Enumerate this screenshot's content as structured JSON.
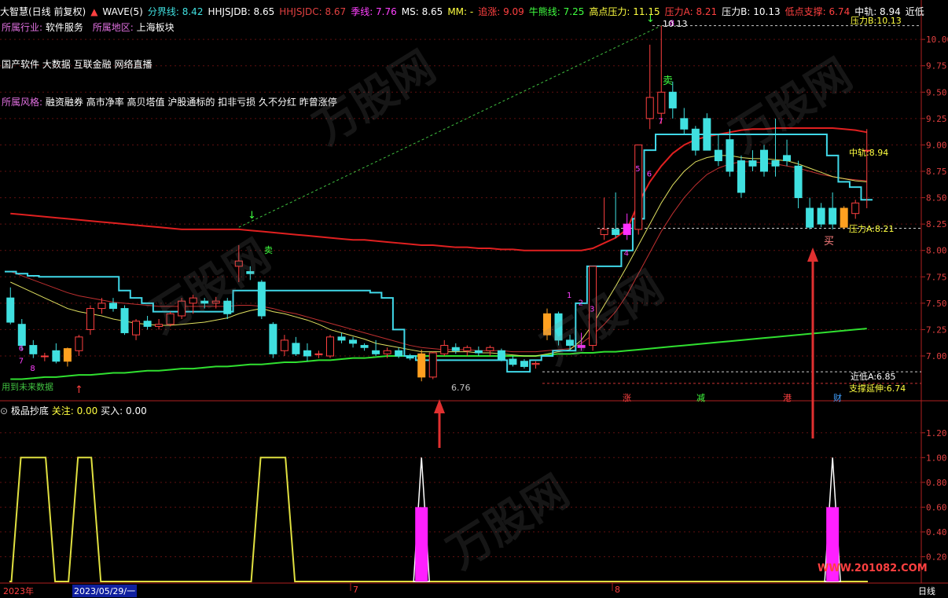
{
  "header": {
    "title": "大智慧(日线 前复权)",
    "indicator": "WAVE(5)",
    "items": [
      {
        "label": "分界线: 8.42",
        "color": "#40e0e0"
      },
      {
        "label": "HHJSJDB: 8.65",
        "color": "#ffffff"
      },
      {
        "label": "HHJSJDC: 8.67",
        "color": "#e04040"
      },
      {
        "label": "季线: 7.76",
        "color": "#ff40ff"
      },
      {
        "label": "MS: 8.65",
        "color": "#ffffff"
      },
      {
        "label": "MM: -",
        "color": "#ffff40"
      },
      {
        "label": "追涨: 9.09",
        "color": "#ff4040"
      },
      {
        "label": "牛熊线: 7.25",
        "color": "#40ff40"
      },
      {
        "label": "高点压力: 11.15",
        "color": "#ffff40"
      },
      {
        "label": "压力A: 8.21",
        "color": "#ff4040"
      },
      {
        "label": "压力B: 10.13",
        "color": "#ffffff"
      },
      {
        "label": "低点支撑: 6.74",
        "color": "#ff4040"
      },
      {
        "label": "中轨: 8.94",
        "color": "#ffffff"
      },
      {
        "label": "近低",
        "color": "#ffffff"
      }
    ]
  },
  "info": {
    "industry_label": "所属行业:",
    "industry_value": "软件服务",
    "region_label": "所属地区:",
    "region_value": "上海板块",
    "concepts": "国产软件 大数据 互联金融 网络直播",
    "style_label": "所属风格:",
    "style_value": "融资融券 高市净率 高贝塔值 沪股通标的 扣非亏损 久不分红 昨曾涨停"
  },
  "sub_header": {
    "name": "极品抄底",
    "focus_label": "关注: 0.00",
    "buy_label": "买入: 0.00"
  },
  "annotations": {
    "sell1": "卖",
    "sell2": "卖",
    "buy": "买",
    "press_b": "10.13",
    "press_b_label": "压力B:10.13",
    "mid_label": "中轨:8.94",
    "press_a_label": "压力A:8.21",
    "near_low_label": "近低A:6.85",
    "support_label": "支撑延伸:6.74",
    "low_mark": "6.76",
    "used_data": "用到未来数据",
    "zhang": "涨",
    "jian": "减",
    "gang": "港",
    "cai": "财",
    "wave_labels": [
      "1",
      "2",
      "3",
      "4",
      "5",
      "6",
      "7",
      "8"
    ]
  },
  "bottom": {
    "year": "2023年",
    "date": "2023/05/29/一",
    "m7": "7",
    "m8": "8",
    "period": "日线"
  },
  "watermark": "万股网",
  "watermark_url": "WWW.201082.COM",
  "colors": {
    "up": "#ff4040",
    "down": "#40e0e0",
    "bg": "#000000"
  },
  "chart_data": {
    "type": "candlestick",
    "main_ylim": [
      6.65,
      10.15
    ],
    "main_yticks": [
      7.0,
      7.25,
      7.5,
      7.75,
      8.0,
      8.25,
      8.5,
      8.75,
      9.0,
      9.25,
      9.5,
      9.75,
      10.0
    ],
    "sub_ylim": [
      0,
      1.3
    ],
    "sub_yticks": [
      0.2,
      0.4,
      0.6,
      0.8,
      1.0,
      1.2
    ],
    "candles": [
      [
        7.55,
        7.65,
        7.3,
        7.32
      ],
      [
        7.3,
        7.35,
        7.05,
        7.1
      ],
      [
        7.1,
        7.15,
        6.98,
        7.02
      ],
      [
        7.0,
        7.03,
        6.95,
        7.0
      ],
      [
        7.05,
        7.12,
        6.93,
        6.95
      ],
      [
        6.95,
        7.08,
        6.9,
        7.07
      ],
      [
        7.05,
        7.2,
        7.0,
        7.18
      ],
      [
        7.25,
        7.48,
        7.2,
        7.45
      ],
      [
        7.45,
        7.55,
        7.4,
        7.5
      ],
      [
        7.5,
        7.55,
        7.42,
        7.45
      ],
      [
        7.45,
        7.48,
        7.2,
        7.22
      ],
      [
        7.2,
        7.35,
        7.15,
        7.33
      ],
      [
        7.33,
        7.38,
        7.25,
        7.28
      ],
      [
        7.28,
        7.35,
        7.25,
        7.3
      ],
      [
        7.3,
        7.42,
        7.28,
        7.4
      ],
      [
        7.38,
        7.55,
        7.35,
        7.52
      ],
      [
        7.5,
        7.58,
        7.4,
        7.55
      ],
      [
        7.52,
        7.55,
        7.45,
        7.5
      ],
      [
        7.5,
        7.56,
        7.45,
        7.52
      ],
      [
        7.52,
        7.55,
        7.35,
        7.4
      ],
      [
        7.85,
        8.05,
        7.7,
        7.9
      ],
      [
        7.8,
        7.85,
        7.72,
        7.78
      ],
      [
        7.7,
        7.72,
        7.35,
        7.38
      ],
      [
        7.3,
        7.32,
        6.98,
        7.02
      ],
      [
        7.05,
        7.2,
        7.0,
        7.15
      ],
      [
        7.12,
        7.18,
        7.0,
        7.02
      ],
      [
        7.05,
        7.12,
        6.95,
        7.0
      ],
      [
        7.02,
        7.05,
        6.98,
        7.02
      ],
      [
        7.0,
        7.2,
        6.98,
        7.18
      ],
      [
        7.18,
        7.22,
        7.12,
        7.15
      ],
      [
        7.15,
        7.18,
        7.08,
        7.12
      ],
      [
        7.1,
        7.12,
        7.05,
        7.08
      ],
      [
        7.05,
        7.15,
        7.0,
        7.02
      ],
      [
        7.02,
        7.08,
        6.98,
        7.05
      ],
      [
        7.05,
        7.08,
        6.98,
        7.0
      ],
      [
        7.0,
        7.02,
        6.96,
        6.98
      ],
      [
        7.02,
        7.06,
        6.76,
        6.8
      ],
      [
        6.8,
        7.04,
        6.78,
        7.03
      ],
      [
        7.02,
        7.15,
        7.0,
        7.1
      ],
      [
        7.08,
        7.12,
        7.02,
        7.05
      ],
      [
        7.05,
        7.1,
        7.0,
        7.08
      ],
      [
        7.05,
        7.09,
        7.0,
        7.03
      ],
      [
        7.05,
        7.1,
        7.0,
        7.08
      ],
      [
        7.05,
        7.07,
        6.95,
        6.97
      ],
      [
        6.97,
        7.0,
        6.9,
        6.92
      ],
      [
        6.95,
        6.97,
        6.88,
        6.9
      ],
      [
        6.92,
        6.95,
        6.88,
        6.93
      ],
      [
        7.2,
        7.45,
        7.15,
        7.4
      ],
      [
        7.4,
        7.42,
        7.1,
        7.15
      ],
      [
        7.15,
        7.2,
        7.05,
        7.1
      ],
      [
        7.08,
        7.22,
        7.05,
        7.1
      ],
      [
        7.1,
        7.85,
        7.05,
        7.85
      ],
      [
        8.15,
        8.5,
        8.1,
        8.2
      ],
      [
        8.2,
        8.55,
        8.12,
        8.15
      ],
      [
        8.15,
        8.35,
        8.1,
        8.25
      ],
      [
        8.2,
        9.0,
        8.15,
        9.0
      ],
      [
        9.25,
        9.95,
        9.15,
        9.45
      ],
      [
        9.3,
        10.13,
        9.2,
        9.5
      ],
      [
        9.5,
        9.6,
        9.25,
        9.35
      ],
      [
        9.25,
        9.35,
        9.1,
        9.15
      ],
      [
        9.15,
        9.18,
        8.9,
        8.95
      ],
      [
        9.25,
        9.3,
        8.95,
        8.95
      ],
      [
        8.95,
        9.1,
        8.8,
        8.85
      ],
      [
        9.05,
        9.15,
        8.7,
        8.75
      ],
      [
        8.85,
        8.9,
        8.5,
        8.55
      ],
      [
        8.85,
        8.95,
        8.75,
        8.8
      ],
      [
        8.95,
        9.0,
        8.7,
        8.75
      ],
      [
        8.85,
        9.25,
        8.7,
        8.8
      ],
      [
        8.9,
        9.05,
        8.8,
        8.85
      ],
      [
        8.8,
        8.85,
        8.4,
        8.5
      ],
      [
        8.4,
        8.5,
        8.2,
        8.22
      ],
      [
        8.4,
        8.45,
        8.22,
        8.25
      ],
      [
        8.4,
        8.55,
        8.2,
        8.25
      ],
      [
        8.4,
        8.42,
        8.2,
        8.22
      ],
      [
        8.35,
        8.48,
        8.3,
        8.45
      ],
      [
        8.95,
        9.15,
        8.4,
        8.95
      ]
    ],
    "filled_up_idx": [
      50,
      54
    ],
    "orange_idx": [
      5,
      36,
      47,
      73
    ],
    "magenta_idx": [
      50,
      54
    ],
    "boll_upper": [
      7.8,
      7.78,
      7.76,
      7.75,
      7.75,
      7.75,
      7.75,
      7.75,
      7.75,
      7.75,
      7.62,
      7.55,
      7.5,
      7.42,
      7.42,
      7.42,
      7.42,
      7.42,
      7.42,
      7.42,
      7.62,
      7.62,
      7.62,
      7.62,
      7.62,
      7.62,
      7.62,
      7.62,
      7.62,
      7.62,
      7.62,
      7.62,
      7.6,
      7.55,
      7.25,
      7.0,
      6.96,
      6.96,
      6.96,
      6.96,
      6.96,
      6.96,
      6.96,
      6.96,
      6.85,
      6.85,
      6.96,
      7.0,
      7.05,
      7.05,
      7.5,
      7.85,
      7.85,
      7.85,
      8.0,
      8.3,
      8.95,
      9.1,
      9.1,
      9.1,
      9.1,
      9.1,
      9.1,
      9.1,
      9.1,
      9.1,
      9.1,
      9.1,
      9.1,
      9.1,
      9.1,
      9.1,
      8.9,
      8.65,
      8.6,
      8.48
    ],
    "red_curve": [
      8.35,
      8.34,
      8.33,
      8.32,
      8.31,
      8.3,
      8.29,
      8.28,
      8.27,
      8.26,
      8.25,
      8.24,
      8.23,
      8.22,
      8.21,
      8.2,
      8.2,
      8.2,
      8.2,
      8.2,
      8.2,
      8.19,
      8.18,
      8.17,
      8.16,
      8.15,
      8.14,
      8.13,
      8.12,
      8.11,
      8.1,
      8.1,
      8.09,
      8.08,
      8.07,
      8.06,
      8.05,
      8.05,
      8.04,
      8.03,
      8.03,
      8.02,
      8.02,
      8.01,
      8.01,
      8.0,
      8.0,
      8.0,
      8.0,
      8.0,
      8.0,
      8.02,
      8.07,
      8.12,
      8.2,
      8.45,
      8.65,
      8.8,
      8.92,
      9.0,
      9.05,
      9.08,
      9.1,
      9.12,
      9.14,
      9.15,
      9.15,
      9.16,
      9.16,
      9.16,
      9.16,
      9.16,
      9.16,
      9.15,
      9.14,
      9.12
    ],
    "green_curve": [
      6.78,
      6.78,
      6.79,
      6.8,
      6.8,
      6.81,
      6.82,
      6.82,
      6.83,
      6.84,
      6.84,
      6.85,
      6.86,
      6.86,
      6.87,
      6.88,
      6.88,
      6.89,
      6.9,
      6.9,
      6.91,
      6.92,
      6.92,
      6.93,
      6.94,
      6.94,
      6.95,
      6.96,
      6.96,
      6.97,
      6.98,
      6.98,
      6.99,
      7.0,
      7.0,
      7.0,
      7.0,
      7.0,
      7.0,
      7.0,
      7.0,
      7.0,
      7.0,
      7.0,
      7.0,
      7.0,
      7.0,
      7.01,
      7.02,
      7.02,
      7.03,
      7.03,
      7.04,
      7.04,
      7.05,
      7.06,
      7.07,
      7.08,
      7.09,
      7.1,
      7.11,
      7.12,
      7.13,
      7.14,
      7.15,
      7.16,
      7.17,
      7.18,
      7.19,
      7.2,
      7.21,
      7.22,
      7.23,
      7.24,
      7.25,
      7.26
    ],
    "ma_yellow": [
      7.7,
      7.65,
      7.6,
      7.55,
      7.5,
      7.45,
      7.42,
      7.4,
      7.38,
      7.35,
      7.33,
      7.31,
      7.3,
      7.29,
      7.29,
      7.3,
      7.31,
      7.32,
      7.34,
      7.36,
      7.4,
      7.43,
      7.45,
      7.42,
      7.4,
      7.37,
      7.34,
      7.3,
      7.25,
      7.22,
      7.19,
      7.16,
      7.12,
      7.1,
      7.08,
      7.06,
      7.04,
      7.04,
      7.04,
      7.04,
      7.04,
      7.03,
      7.03,
      7.02,
      7.01,
      7.0,
      7.0,
      7.02,
      7.04,
      7.06,
      7.15,
      7.3,
      7.48,
      7.66,
      7.85,
      8.05,
      8.25,
      8.45,
      8.62,
      8.75,
      8.84,
      8.88,
      8.9,
      8.9,
      8.88,
      8.87,
      8.87,
      8.86,
      8.85,
      8.82,
      8.78,
      8.74,
      8.7,
      8.68,
      8.66,
      8.65
    ],
    "ma_redthin": [
      7.8,
      7.76,
      7.72,
      7.68,
      7.64,
      7.6,
      7.57,
      7.55,
      7.53,
      7.51,
      7.5,
      7.49,
      7.48,
      7.47,
      7.47,
      7.47,
      7.47,
      7.47,
      7.47,
      7.47,
      7.48,
      7.48,
      7.47,
      7.45,
      7.42,
      7.4,
      7.37,
      7.34,
      7.31,
      7.28,
      7.25,
      7.22,
      7.19,
      7.16,
      7.13,
      7.1,
      7.08,
      7.07,
      7.06,
      7.06,
      7.06,
      7.05,
      7.05,
      7.05,
      7.04,
      7.04,
      7.04,
      7.05,
      7.06,
      7.07,
      7.12,
      7.2,
      7.3,
      7.42,
      7.58,
      7.78,
      7.98,
      8.18,
      8.35,
      8.5,
      8.62,
      8.72,
      8.78,
      8.82,
      8.84,
      8.84,
      8.83,
      8.82,
      8.8,
      8.78,
      8.75,
      8.72,
      8.7,
      8.68,
      8.67,
      8.66
    ],
    "sub_series": [
      0,
      1,
      1,
      1,
      0,
      0,
      1,
      1,
      0,
      0,
      0,
      0,
      0,
      0,
      0,
      0,
      0,
      0,
      0,
      0,
      0,
      0,
      1,
      1,
      1,
      0,
      0,
      0,
      0,
      0,
      0,
      0,
      0,
      0,
      0,
      0,
      0,
      0,
      0,
      0,
      0,
      0,
      0,
      0,
      0,
      0,
      0,
      0,
      0,
      0,
      0,
      0,
      0,
      0,
      0,
      0,
      0,
      0,
      0,
      0,
      0,
      0,
      0,
      0,
      0,
      0,
      0,
      0,
      0,
      0,
      0,
      0,
      0,
      0,
      0,
      0
    ],
    "sub_spikes": [
      {
        "idx": 36,
        "value": 1.0,
        "fill": 0.6
      },
      {
        "idx": 72,
        "value": 1.0,
        "fill": 0.6
      }
    ]
  }
}
